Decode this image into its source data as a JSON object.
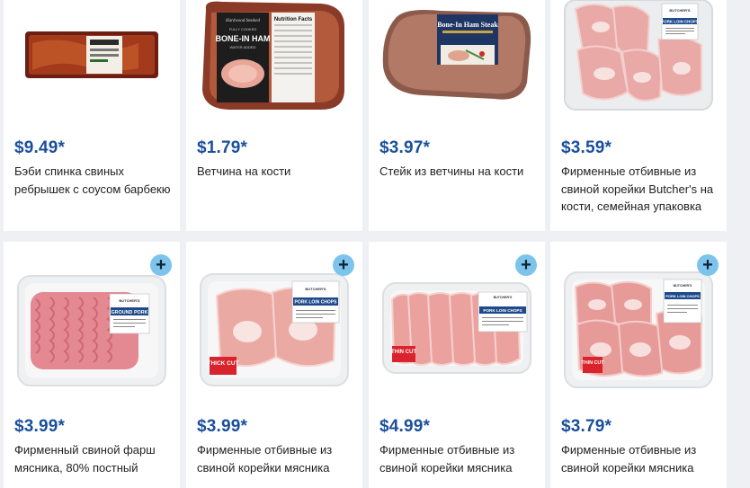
{
  "products": [
    {
      "price": "$9.49*",
      "name": "Бэби спинка свиных ребрышек с соусом барбекю",
      "image_label": "",
      "has_add": false
    },
    {
      "price": "$1.79*",
      "name": "Ветчина на кости",
      "image_label": "BONE-IN HAM",
      "image_label_top": "Hardwood Smoked",
      "image_label_small": "WATER ADDED",
      "image_panel": "Nutrition Facts",
      "has_add": false
    },
    {
      "price": "$3.97*",
      "name": "Стейк из ветчины на кости",
      "image_label": "Bone-In Ham Steak",
      "has_add": false
    },
    {
      "price": "$3.59*",
      "name": "Фирменные отбивные из свиной корейки Butcher's на кости, семейная упаковка",
      "image_label": "PORK LOIN CHOPS",
      "image_brand": "BUTCHER'S",
      "has_add": false
    },
    {
      "price": "$3.99*",
      "name": "Фирменный свиной фарш мясника, 80% постный",
      "image_label": "GROUND PORK",
      "image_brand": "BUTCHER'S",
      "has_add": true
    },
    {
      "price": "$3.99*",
      "name": "Фирменные отбивные из свиной корейки мясника",
      "image_label": "PORK LOIN CHOPS",
      "image_brand": "BUTCHER'S",
      "image_tag": "THICK CUT",
      "has_add": true
    },
    {
      "price": "$4.99*",
      "name": "Фирменные отбивные из свиной корейки мясника",
      "image_label": "PORK LOIN CHOPS",
      "image_brand": "BUTCHER'S",
      "image_tag": "THIN CUT",
      "has_add": true
    },
    {
      "price": "$3.79*",
      "name": "Фирменные отбивные из свиной корейки мясника",
      "image_label": "PORK LOIN CHOPS",
      "image_brand": "BUTCHER'S",
      "image_tag": "THIN CUT",
      "has_add": true
    }
  ],
  "ui": {
    "add_glyph": "+",
    "add_icon": "plus-icon",
    "accent_color": "#1a4f9c",
    "add_button_color": "#7cc4ec"
  }
}
